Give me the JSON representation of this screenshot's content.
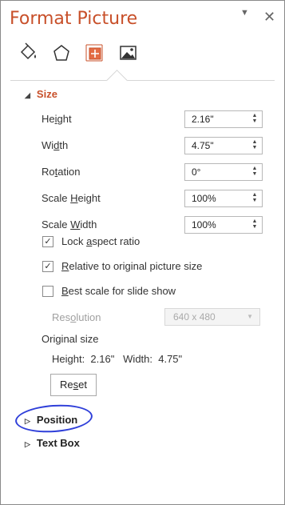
{
  "panel": {
    "title": "Format Picture",
    "tabs": [
      {
        "name": "fill-line",
        "icon": "paint-bucket-icon"
      },
      {
        "name": "effects",
        "icon": "pentagon-icon"
      },
      {
        "name": "size-properties",
        "icon": "size-properties-icon",
        "active": true
      },
      {
        "name": "picture",
        "icon": "picture-icon"
      }
    ]
  },
  "size": {
    "header": "Size",
    "height": {
      "label_pre": "He",
      "label_u": "i",
      "label_post": "ght",
      "value": "2.16\""
    },
    "width": {
      "label_pre": "Wi",
      "label_u": "d",
      "label_post": "th",
      "value": "4.75\""
    },
    "rotation": {
      "label_pre": "Ro",
      "label_u": "t",
      "label_post": "ation",
      "value": "0°"
    },
    "scale_height": {
      "label_pre": "Scale ",
      "label_u": "H",
      "label_post": "eight",
      "value": "100%"
    },
    "scale_width": {
      "label_pre": "Scale ",
      "label_u": "W",
      "label_post": "idth",
      "value": "100%"
    },
    "lock_aspect": {
      "label_pre": "Lock ",
      "label_u": "a",
      "label_post": "spect ratio",
      "checked": true
    },
    "relative_original": {
      "label_pre": "",
      "label_u": "R",
      "label_post": "elative to original picture size",
      "checked": true
    },
    "best_scale": {
      "label_pre": "",
      "label_u": "B",
      "label_post": "est scale for slide show",
      "checked": false
    },
    "resolution": {
      "label_pre": "Res",
      "label_u": "o",
      "label_post": "lution",
      "value": "640 x 480"
    },
    "original_size_label": "Original size",
    "original_size_values": "Height:  2.16\"   Width:  4.75\"",
    "reset": {
      "label_pre": "Re",
      "label_u": "s",
      "label_post": "et"
    }
  },
  "sections": {
    "position": "Position",
    "text_box": "Text Box"
  },
  "colors": {
    "accent": "#c8502a",
    "annotation": "#2f3fd9"
  }
}
